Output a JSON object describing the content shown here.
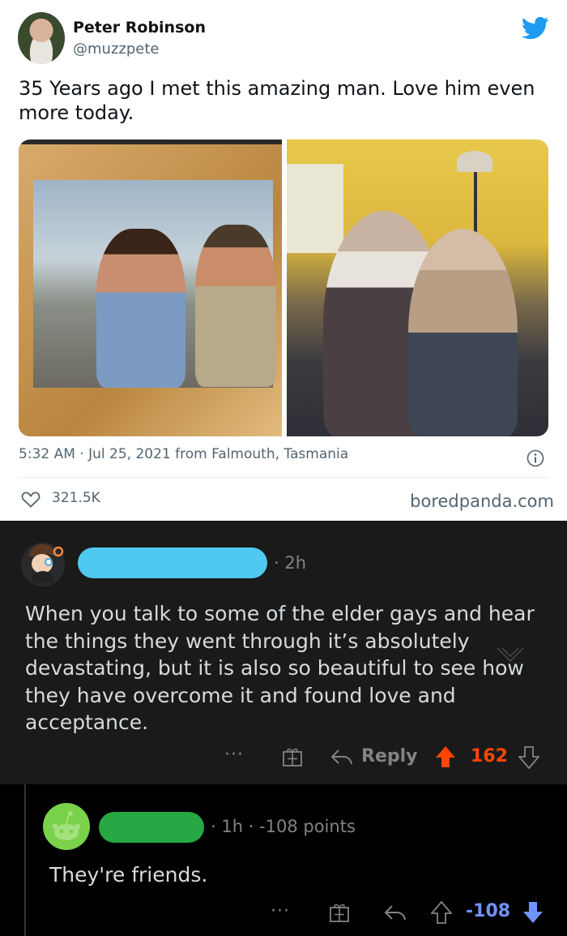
{
  "tweet": {
    "display_name": "Peter Robinson",
    "handle": "@muzzpete",
    "text": "35 Years ago I met this amazing man. Love him even more today.",
    "meta": "5:32 AM · Jul 25, 2021 from Falmouth, Tasmania",
    "likes": "321.5K",
    "watermark": "boredpanda.com",
    "brand_color": "#1d9bf0",
    "icons": [
      "twitter-bird-icon",
      "info-icon",
      "heart-icon"
    ]
  },
  "comment1": {
    "username_color": "#4fc9f0",
    "time": "· 2h",
    "text": "When you talk to some of the elder gays and hear the things they went through it’s absolutely devastating, but it is also so beautiful to see how they have overcome it and found love and acceptance.",
    "more": "···",
    "reply_label": "Reply",
    "score": "162",
    "score_color": "#ff4500"
  },
  "comment2": {
    "username_color": "#27a844",
    "meta": "· 1h  ·  -108 points",
    "text": "They're friends.",
    "more": "···",
    "score": "-108",
    "score_color": "#7193ff"
  }
}
